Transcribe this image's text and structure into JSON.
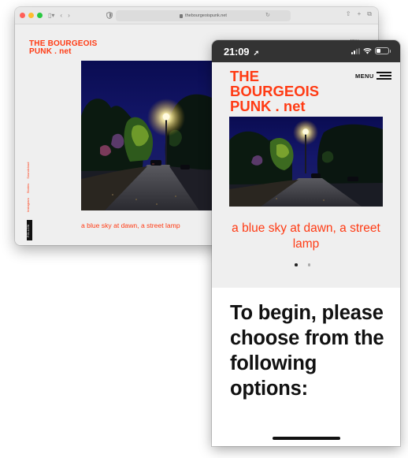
{
  "browser": {
    "url": "thebourgeoispunk.net",
    "nav_back": "‹",
    "nav_forward": "›",
    "share_icon": "share-icon",
    "new_tab_icon": "plus-icon",
    "tabs_icon": "tabs-icon"
  },
  "site": {
    "logo_line1": "THE BOURGEOIS",
    "logo_line2": "PUNK . net",
    "menu_label": "Menu",
    "caption": "a blue sky at dawn, a street lamp",
    "side_links": [
      "Instagram",
      "Stories",
      "Soundcloud"
    ],
    "follow_label": "FOLLOW"
  },
  "phone": {
    "time": "21:09",
    "logo_line1": "THE",
    "logo_line2": "BOURGEOIS",
    "logo_line3": "PUNK . net",
    "menu_label": "MENU",
    "caption": "a blue sky at dawn, a street lamp",
    "heading": "To begin, please choose from the following options:"
  },
  "colors": {
    "accent": "#ff3b14",
    "page_bg": "#efefef",
    "status_bar": "#333333"
  }
}
